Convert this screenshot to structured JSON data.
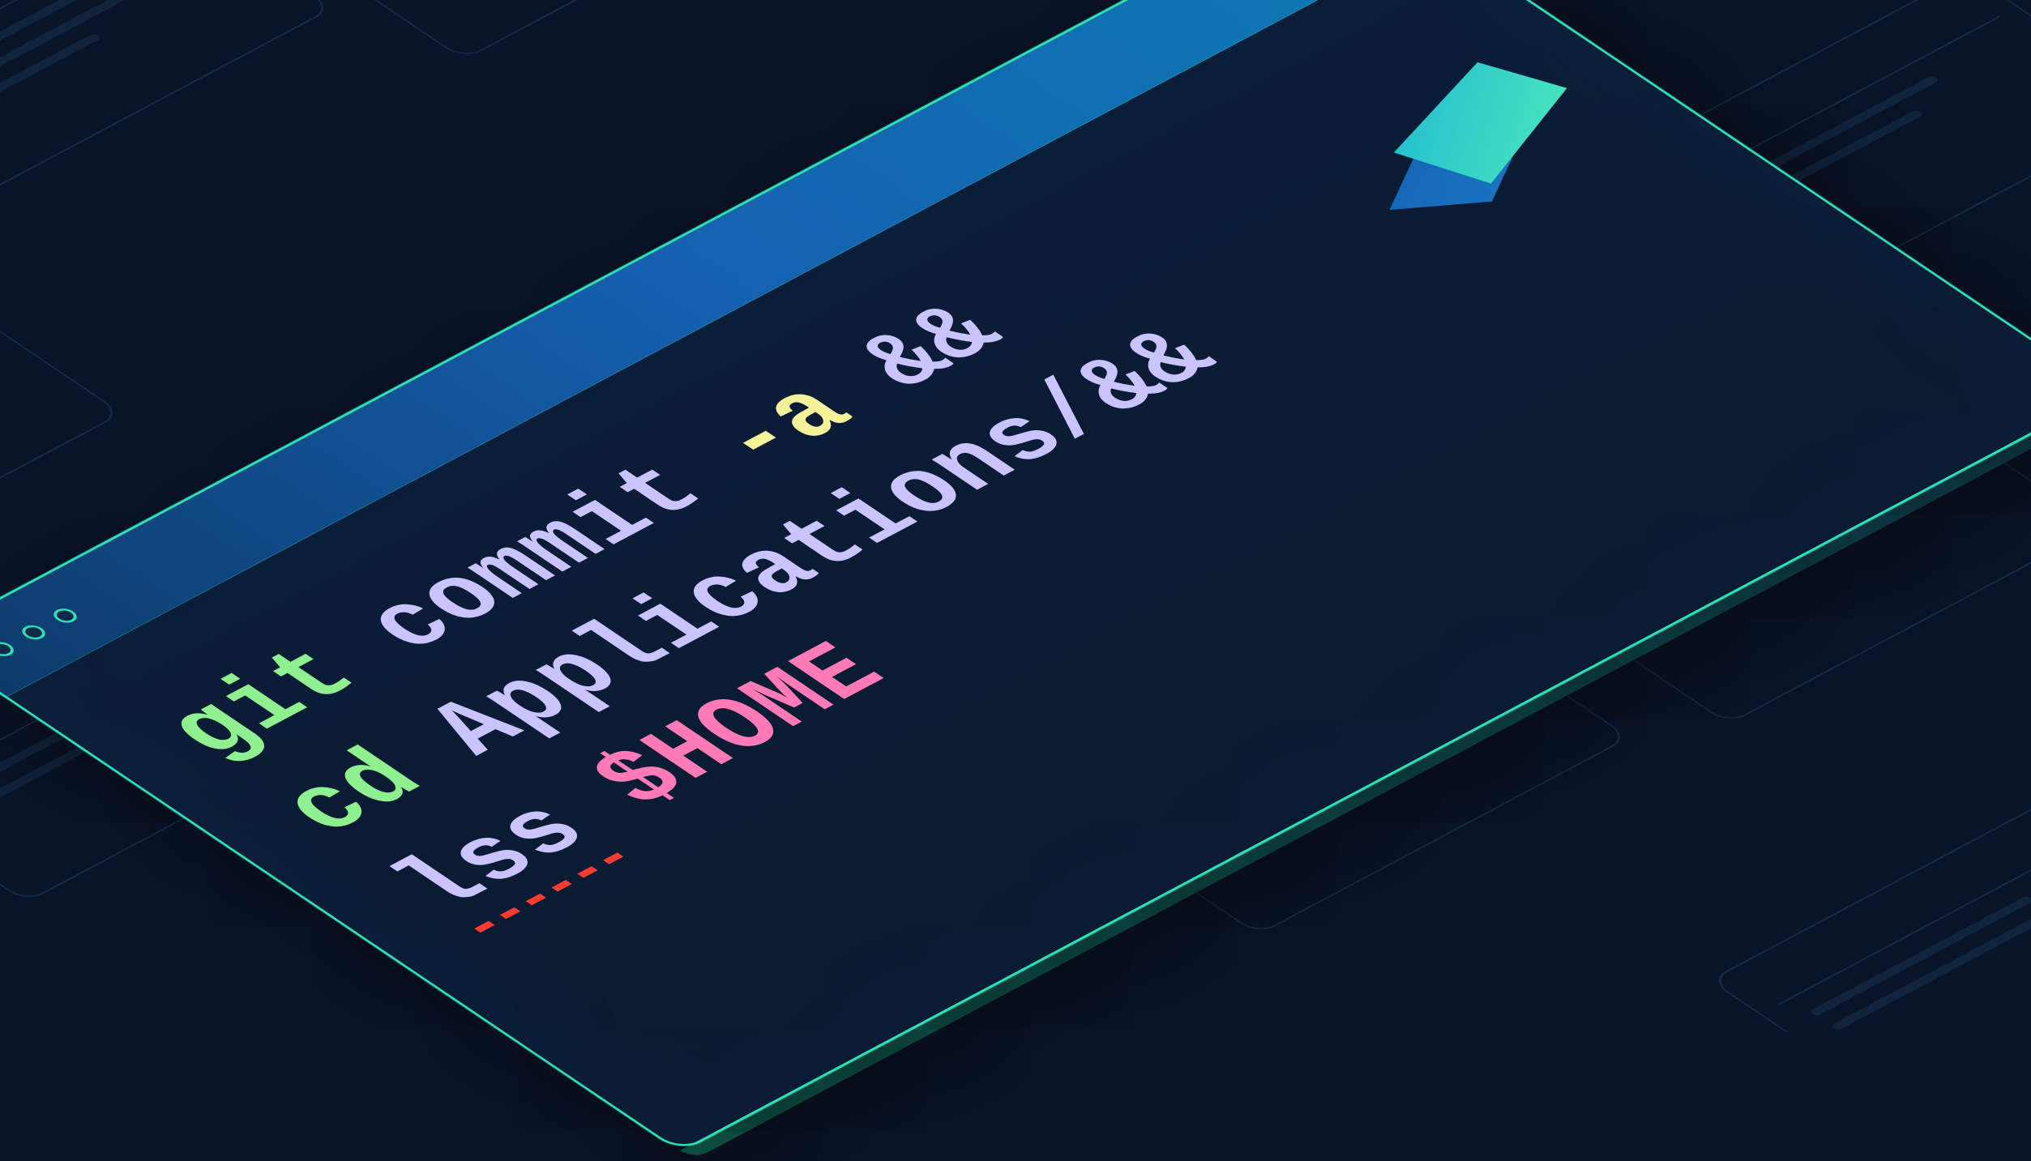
{
  "window": {
    "traffic_lights": 3
  },
  "code": {
    "lines": [
      {
        "tokens": [
          {
            "text": "git",
            "cls": "tok-cmd"
          },
          {
            "text": " ",
            "cls": "tok-plain"
          },
          {
            "text": "commit",
            "cls": "tok-sub"
          },
          {
            "text": " ",
            "cls": "tok-plain"
          },
          {
            "text": "-a",
            "cls": "tok-flag"
          },
          {
            "text": " ",
            "cls": "tok-plain"
          },
          {
            "text": "&&",
            "cls": "tok-op"
          }
        ]
      },
      {
        "tokens": [
          {
            "text": "cd",
            "cls": "tok-cmd"
          },
          {
            "text": " ",
            "cls": "tok-plain"
          },
          {
            "text": "Applications/",
            "cls": "tok-path"
          },
          {
            "text": "&&",
            "cls": "tok-op"
          }
        ]
      },
      {
        "tokens": [
          {
            "text": "lss",
            "cls": "tok-err",
            "error": true
          },
          {
            "text": " ",
            "cls": "tok-plain"
          },
          {
            "text": "$HOME",
            "cls": "tok-var"
          }
        ]
      }
    ]
  },
  "colors": {
    "bg": "#0a1428",
    "window_border": "#2de0b8",
    "titlebar_gradient": [
      "#0d3a6a",
      "#1560b0",
      "#0d7ab4"
    ],
    "cmd": "#8ef08e",
    "arg": "#c9c4ff",
    "flag": "#f5f29a",
    "var": "#ff7ab6",
    "error_underline": "#ff3b30"
  },
  "logo": {
    "name": "warp-logo"
  }
}
